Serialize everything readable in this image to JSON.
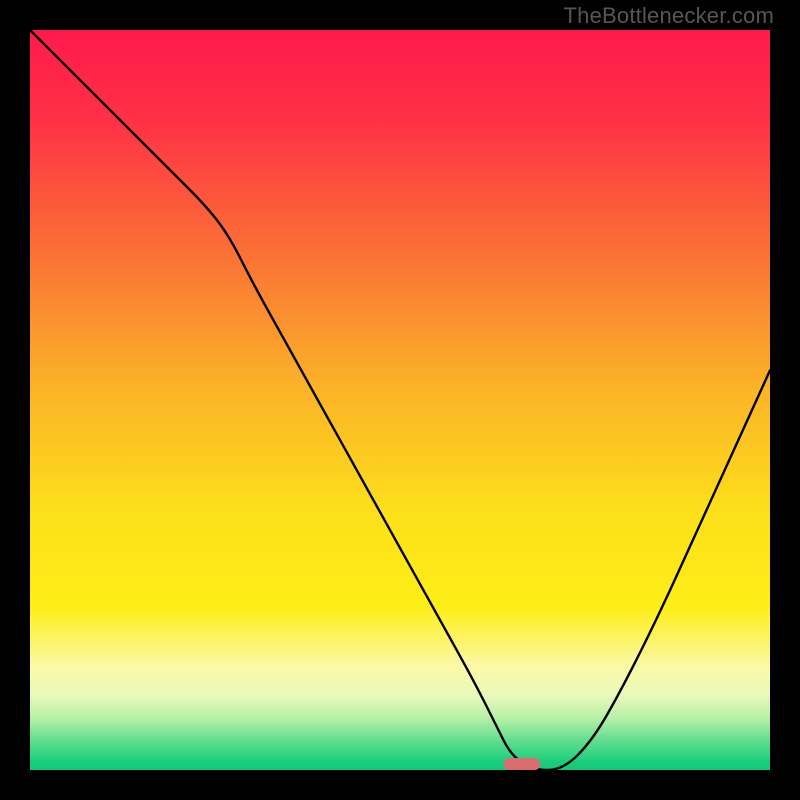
{
  "watermark": "TheBottlenecker.com",
  "chart_data": {
    "type": "line",
    "title": "",
    "xlabel": "",
    "ylabel": "",
    "xlim": [
      0,
      100
    ],
    "ylim": [
      0,
      100
    ],
    "grid": false,
    "series": [
      {
        "name": "bottleneck-curve",
        "x": [
          0,
          6,
          12,
          18,
          24,
          27,
          30,
          35,
          40,
          45,
          50,
          55,
          60,
          63,
          65,
          68,
          72,
          76,
          80,
          85,
          90,
          95,
          100
        ],
        "values": [
          100,
          94,
          88,
          82,
          76,
          72,
          66,
          57,
          48,
          39,
          30,
          21,
          12,
          6,
          2,
          0,
          0,
          4,
          11,
          21,
          32,
          43,
          54
        ]
      }
    ],
    "gradient_stops": [
      {
        "pct": 0,
        "color": "#ff1a4b"
      },
      {
        "pct": 12,
        "color": "#ff3045"
      },
      {
        "pct": 30,
        "color": "#fb7036"
      },
      {
        "pct": 48,
        "color": "#fbb228"
      },
      {
        "pct": 65,
        "color": "#fcdf1a"
      },
      {
        "pct": 78,
        "color": "#feee17"
      },
      {
        "pct": 86,
        "color": "#fcf9a8"
      },
      {
        "pct": 90,
        "color": "#e8f9b8"
      },
      {
        "pct": 93,
        "color": "#b7f0a8"
      },
      {
        "pct": 96,
        "color": "#63dd8e"
      },
      {
        "pct": 98.8,
        "color": "#1cce7e"
      },
      {
        "pct": 100,
        "color": "#12c979"
      }
    ],
    "marker": {
      "x_center_pct": 66.5,
      "y_pct": 99.2,
      "width_pct": 5.0,
      "color": "#d96d6d"
    }
  }
}
